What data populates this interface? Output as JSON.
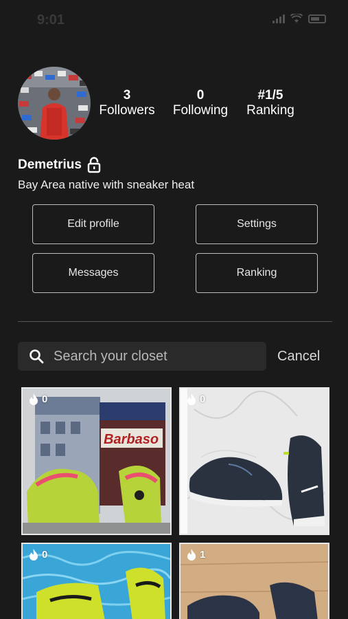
{
  "status": {
    "time": "9:01"
  },
  "profile": {
    "name": "Demetrius",
    "bio": "Bay Area native with sneaker heat",
    "stats": [
      {
        "value": "3",
        "label": "Followers"
      },
      {
        "value": "0",
        "label": "Following"
      },
      {
        "value": "#1/5",
        "label": "Ranking"
      }
    ]
  },
  "actions": {
    "edit_profile": "Edit profile",
    "settings": "Settings",
    "messages": "Messages",
    "ranking": "Ranking"
  },
  "search": {
    "placeholder": "Search your closet",
    "cancel": "Cancel"
  },
  "closet": [
    {
      "count": "0"
    },
    {
      "count": "0"
    },
    {
      "count": "0"
    },
    {
      "count": "1"
    }
  ],
  "colors": {
    "background": "#1a1a1a",
    "search_bg": "#2a2a2a",
    "border": "#bdbdbd"
  }
}
